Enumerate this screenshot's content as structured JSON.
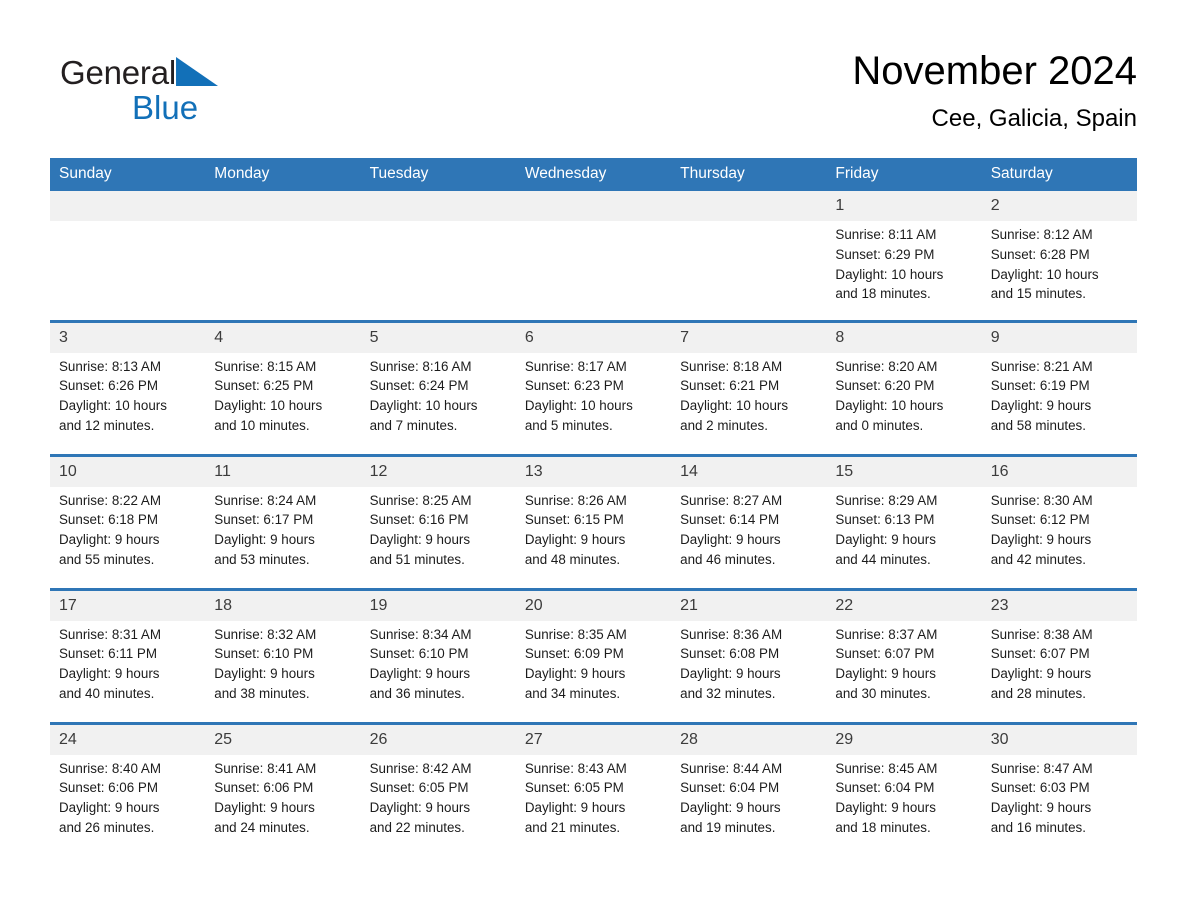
{
  "brand": {
    "name_part1": "General",
    "name_part2": "Blue",
    "triangle_color": "#1270b8"
  },
  "header": {
    "month_title": "November 2024",
    "location": "Cee, Galicia, Spain"
  },
  "theme": {
    "header_blue": "#2f76b6",
    "daynum_gray": "#f1f1f1",
    "text_black": "#1c1c1c"
  },
  "weekdays": [
    "Sunday",
    "Monday",
    "Tuesday",
    "Wednesday",
    "Thursday",
    "Friday",
    "Saturday"
  ],
  "labels": {
    "sunrise_prefix": "Sunrise: ",
    "sunset_prefix": "Sunset: ",
    "daylight_prefix": "Daylight: "
  },
  "weeks": [
    [
      {
        "day": "",
        "sunrise": "",
        "sunset": "",
        "daylight_line1": "",
        "daylight_line2": ""
      },
      {
        "day": "",
        "sunrise": "",
        "sunset": "",
        "daylight_line1": "",
        "daylight_line2": ""
      },
      {
        "day": "",
        "sunrise": "",
        "sunset": "",
        "daylight_line1": "",
        "daylight_line2": ""
      },
      {
        "day": "",
        "sunrise": "",
        "sunset": "",
        "daylight_line1": "",
        "daylight_line2": ""
      },
      {
        "day": "",
        "sunrise": "",
        "sunset": "",
        "daylight_line1": "",
        "daylight_line2": ""
      },
      {
        "day": "1",
        "sunrise": "Sunrise: 8:11 AM",
        "sunset": "Sunset: 6:29 PM",
        "daylight_line1": "Daylight: 10 hours",
        "daylight_line2": "and 18 minutes."
      },
      {
        "day": "2",
        "sunrise": "Sunrise: 8:12 AM",
        "sunset": "Sunset: 6:28 PM",
        "daylight_line1": "Daylight: 10 hours",
        "daylight_line2": "and 15 minutes."
      }
    ],
    [
      {
        "day": "3",
        "sunrise": "Sunrise: 8:13 AM",
        "sunset": "Sunset: 6:26 PM",
        "daylight_line1": "Daylight: 10 hours",
        "daylight_line2": "and 12 minutes."
      },
      {
        "day": "4",
        "sunrise": "Sunrise: 8:15 AM",
        "sunset": "Sunset: 6:25 PM",
        "daylight_line1": "Daylight: 10 hours",
        "daylight_line2": "and 10 minutes."
      },
      {
        "day": "5",
        "sunrise": "Sunrise: 8:16 AM",
        "sunset": "Sunset: 6:24 PM",
        "daylight_line1": "Daylight: 10 hours",
        "daylight_line2": "and 7 minutes."
      },
      {
        "day": "6",
        "sunrise": "Sunrise: 8:17 AM",
        "sunset": "Sunset: 6:23 PM",
        "daylight_line1": "Daylight: 10 hours",
        "daylight_line2": "and 5 minutes."
      },
      {
        "day": "7",
        "sunrise": "Sunrise: 8:18 AM",
        "sunset": "Sunset: 6:21 PM",
        "daylight_line1": "Daylight: 10 hours",
        "daylight_line2": "and 2 minutes."
      },
      {
        "day": "8",
        "sunrise": "Sunrise: 8:20 AM",
        "sunset": "Sunset: 6:20 PM",
        "daylight_line1": "Daylight: 10 hours",
        "daylight_line2": "and 0 minutes."
      },
      {
        "day": "9",
        "sunrise": "Sunrise: 8:21 AM",
        "sunset": "Sunset: 6:19 PM",
        "daylight_line1": "Daylight: 9 hours",
        "daylight_line2": "and 58 minutes."
      }
    ],
    [
      {
        "day": "10",
        "sunrise": "Sunrise: 8:22 AM",
        "sunset": "Sunset: 6:18 PM",
        "daylight_line1": "Daylight: 9 hours",
        "daylight_line2": "and 55 minutes."
      },
      {
        "day": "11",
        "sunrise": "Sunrise: 8:24 AM",
        "sunset": "Sunset: 6:17 PM",
        "daylight_line1": "Daylight: 9 hours",
        "daylight_line2": "and 53 minutes."
      },
      {
        "day": "12",
        "sunrise": "Sunrise: 8:25 AM",
        "sunset": "Sunset: 6:16 PM",
        "daylight_line1": "Daylight: 9 hours",
        "daylight_line2": "and 51 minutes."
      },
      {
        "day": "13",
        "sunrise": "Sunrise: 8:26 AM",
        "sunset": "Sunset: 6:15 PM",
        "daylight_line1": "Daylight: 9 hours",
        "daylight_line2": "and 48 minutes."
      },
      {
        "day": "14",
        "sunrise": "Sunrise: 8:27 AM",
        "sunset": "Sunset: 6:14 PM",
        "daylight_line1": "Daylight: 9 hours",
        "daylight_line2": "and 46 minutes."
      },
      {
        "day": "15",
        "sunrise": "Sunrise: 8:29 AM",
        "sunset": "Sunset: 6:13 PM",
        "daylight_line1": "Daylight: 9 hours",
        "daylight_line2": "and 44 minutes."
      },
      {
        "day": "16",
        "sunrise": "Sunrise: 8:30 AM",
        "sunset": "Sunset: 6:12 PM",
        "daylight_line1": "Daylight: 9 hours",
        "daylight_line2": "and 42 minutes."
      }
    ],
    [
      {
        "day": "17",
        "sunrise": "Sunrise: 8:31 AM",
        "sunset": "Sunset: 6:11 PM",
        "daylight_line1": "Daylight: 9 hours",
        "daylight_line2": "and 40 minutes."
      },
      {
        "day": "18",
        "sunrise": "Sunrise: 8:32 AM",
        "sunset": "Sunset: 6:10 PM",
        "daylight_line1": "Daylight: 9 hours",
        "daylight_line2": "and 38 minutes."
      },
      {
        "day": "19",
        "sunrise": "Sunrise: 8:34 AM",
        "sunset": "Sunset: 6:10 PM",
        "daylight_line1": "Daylight: 9 hours",
        "daylight_line2": "and 36 minutes."
      },
      {
        "day": "20",
        "sunrise": "Sunrise: 8:35 AM",
        "sunset": "Sunset: 6:09 PM",
        "daylight_line1": "Daylight: 9 hours",
        "daylight_line2": "and 34 minutes."
      },
      {
        "day": "21",
        "sunrise": "Sunrise: 8:36 AM",
        "sunset": "Sunset: 6:08 PM",
        "daylight_line1": "Daylight: 9 hours",
        "daylight_line2": "and 32 minutes."
      },
      {
        "day": "22",
        "sunrise": "Sunrise: 8:37 AM",
        "sunset": "Sunset: 6:07 PM",
        "daylight_line1": "Daylight: 9 hours",
        "daylight_line2": "and 30 minutes."
      },
      {
        "day": "23",
        "sunrise": "Sunrise: 8:38 AM",
        "sunset": "Sunset: 6:07 PM",
        "daylight_line1": "Daylight: 9 hours",
        "daylight_line2": "and 28 minutes."
      }
    ],
    [
      {
        "day": "24",
        "sunrise": "Sunrise: 8:40 AM",
        "sunset": "Sunset: 6:06 PM",
        "daylight_line1": "Daylight: 9 hours",
        "daylight_line2": "and 26 minutes."
      },
      {
        "day": "25",
        "sunrise": "Sunrise: 8:41 AM",
        "sunset": "Sunset: 6:06 PM",
        "daylight_line1": "Daylight: 9 hours",
        "daylight_line2": "and 24 minutes."
      },
      {
        "day": "26",
        "sunrise": "Sunrise: 8:42 AM",
        "sunset": "Sunset: 6:05 PM",
        "daylight_line1": "Daylight: 9 hours",
        "daylight_line2": "and 22 minutes."
      },
      {
        "day": "27",
        "sunrise": "Sunrise: 8:43 AM",
        "sunset": "Sunset: 6:05 PM",
        "daylight_line1": "Daylight: 9 hours",
        "daylight_line2": "and 21 minutes."
      },
      {
        "day": "28",
        "sunrise": "Sunrise: 8:44 AM",
        "sunset": "Sunset: 6:04 PM",
        "daylight_line1": "Daylight: 9 hours",
        "daylight_line2": "and 19 minutes."
      },
      {
        "day": "29",
        "sunrise": "Sunrise: 8:45 AM",
        "sunset": "Sunset: 6:04 PM",
        "daylight_line1": "Daylight: 9 hours",
        "daylight_line2": "and 18 minutes."
      },
      {
        "day": "30",
        "sunrise": "Sunrise: 8:47 AM",
        "sunset": "Sunset: 6:03 PM",
        "daylight_line1": "Daylight: 9 hours",
        "daylight_line2": "and 16 minutes."
      }
    ]
  ]
}
